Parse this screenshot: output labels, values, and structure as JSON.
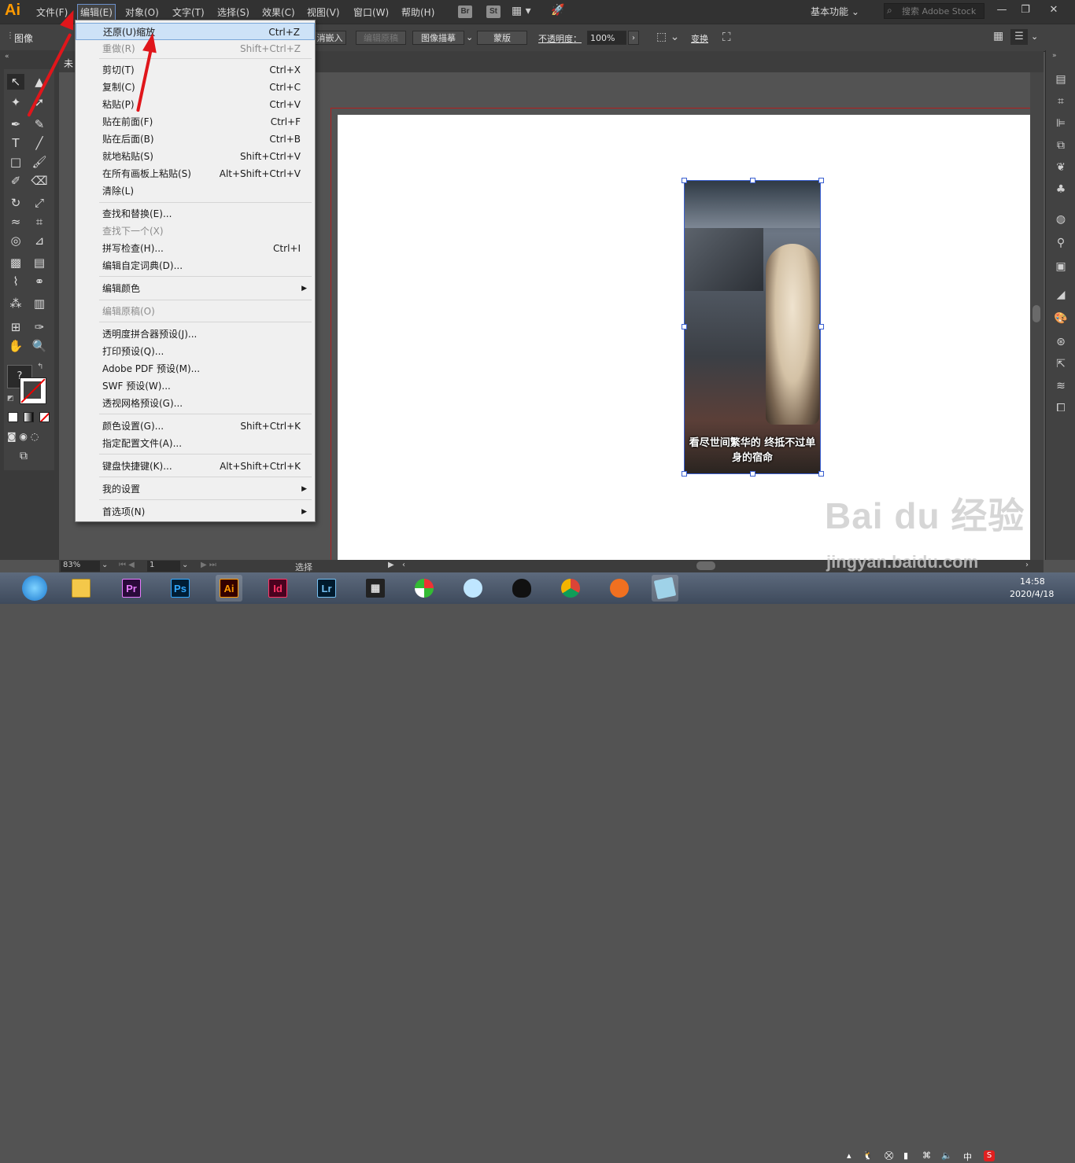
{
  "app": {
    "logo": "Ai"
  },
  "menubar": {
    "items": [
      "文件(F)",
      "编辑(E)",
      "对象(O)",
      "文字(T)",
      "选择(S)",
      "效果(C)",
      "视图(V)",
      "窗口(W)",
      "帮助(H)"
    ],
    "bridge": "Br",
    "stock": "St",
    "workspace": "基本功能",
    "search_placeholder": "搜索 Adobe Stock"
  },
  "controlbar": {
    "left_label": "图像",
    "embed": "消嵌入",
    "edit_original": "编辑原稿",
    "image_trace": "图像描摹",
    "mask": "蒙版",
    "opacity_label": "不透明度：",
    "opacity_value": "100%",
    "transform": "变换"
  },
  "doc_tab": "未",
  "edit_menu": {
    "items": [
      {
        "label": "还原(U)缩放",
        "shortcut": "Ctrl+Z",
        "highlighted": true
      },
      {
        "label": "重做(R)",
        "shortcut": "Shift+Ctrl+Z",
        "disabled": true
      },
      {
        "label": "剪切(T)",
        "shortcut": "Ctrl+X"
      },
      {
        "label": "复制(C)",
        "shortcut": "Ctrl+C"
      },
      {
        "label": "粘贴(P)",
        "shortcut": "Ctrl+V"
      },
      {
        "label": "贴在前面(F)",
        "shortcut": "Ctrl+F"
      },
      {
        "label": "贴在后面(B)",
        "shortcut": "Ctrl+B"
      },
      {
        "label": "就地粘贴(S)",
        "shortcut": "Shift+Ctrl+V"
      },
      {
        "label": "在所有画板上粘贴(S)",
        "shortcut": "Alt+Shift+Ctrl+V"
      },
      {
        "label": "清除(L)",
        "shortcut": ""
      },
      {
        "label": "查找和替换(E)...",
        "shortcut": ""
      },
      {
        "label": "查找下一个(X)",
        "shortcut": "",
        "disabled": true
      },
      {
        "label": "拼写检查(H)...",
        "shortcut": "Ctrl+I"
      },
      {
        "label": "编辑自定词典(D)...",
        "shortcut": ""
      },
      {
        "label": "编辑颜色",
        "shortcut": "",
        "submenu": true
      },
      {
        "label": "编辑原稿(O)",
        "shortcut": "",
        "disabled": true
      },
      {
        "label": "透明度拼合器预设(J)...",
        "shortcut": ""
      },
      {
        "label": "打印预设(Q)...",
        "shortcut": ""
      },
      {
        "label": "Adobe PDF 预设(M)...",
        "shortcut": ""
      },
      {
        "label": "SWF 预设(W)...",
        "shortcut": ""
      },
      {
        "label": "透视网格预设(G)...",
        "shortcut": ""
      },
      {
        "label": "颜色设置(G)...",
        "shortcut": "Shift+Ctrl+K"
      },
      {
        "label": "指定配置文件(A)...",
        "shortcut": ""
      },
      {
        "label": "键盘快捷键(K)...",
        "shortcut": "Alt+Shift+Ctrl+K"
      },
      {
        "label": "我的设置",
        "shortcut": "",
        "submenu": true
      },
      {
        "label": "首选项(N)",
        "shortcut": "",
        "submenu": true
      }
    ]
  },
  "artwork": {
    "caption": "看尽世间繁华的 终抵不过单身的宿命"
  },
  "statusbar": {
    "zoom": "83%",
    "page": "1",
    "status": "选择"
  },
  "taskbar": {
    "apps": [
      {
        "name": "Pr",
        "color": "#2a0a3a",
        "fg": "#e77cff"
      },
      {
        "name": "Ps",
        "color": "#001d34",
        "fg": "#31a8ff"
      },
      {
        "name": "Ai",
        "color": "#330000",
        "fg": "#ff9a00"
      },
      {
        "name": "Id",
        "color": "#49021f",
        "fg": "#ff3366"
      },
      {
        "name": "Lr",
        "color": "#001a2d",
        "fg": "#74c0f2"
      }
    ],
    "time": "14:58",
    "date": "2020/4/18",
    "ime": "中"
  },
  "watermark": {
    "logo": "Bai du 经验",
    "url": "jingyan.baidu.com"
  }
}
